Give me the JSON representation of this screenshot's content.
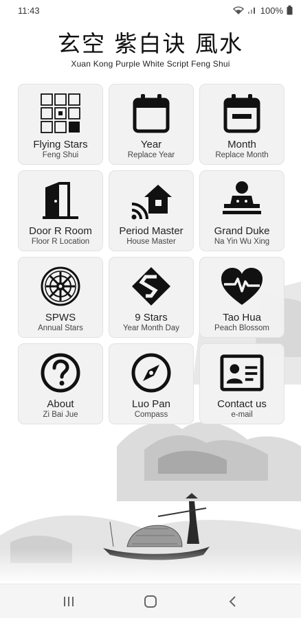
{
  "status_bar": {
    "time": "11:43",
    "battery": "100%",
    "icons": [
      "wifi-icon",
      "signal-icon",
      "battery-icon"
    ]
  },
  "header": {
    "title": "玄空 紫白诀 風水",
    "subtitle": "Xuan Kong Purple White Script Feng Shui"
  },
  "tiles": [
    {
      "icon": "flying-stars-grid-icon",
      "label": "Flying Stars",
      "sub": "Feng Shui"
    },
    {
      "icon": "calendar-icon",
      "label": "Year",
      "sub": "Replace Year"
    },
    {
      "icon": "calendar-month-icon",
      "label": "Month",
      "sub": "Replace Month"
    },
    {
      "icon": "door-icon",
      "label": "Door R Room",
      "sub": "Floor R Location"
    },
    {
      "icon": "house-signal-icon",
      "label": "Period Master",
      "sub": "House Master"
    },
    {
      "icon": "duke-icon",
      "label": "Grand Duke",
      "sub": "Na Yin Wu Xing"
    },
    {
      "icon": "wheel-icon",
      "label": "SPWS",
      "sub": "Annual Stars"
    },
    {
      "icon": "s-diamond-icon",
      "label": "9 Stars",
      "sub": "Year Month Day"
    },
    {
      "icon": "heart-pulse-icon",
      "label": "Tao Hua",
      "sub": "Peach Blossom"
    },
    {
      "icon": "help-circle-icon",
      "label": "About",
      "sub": "Zi Bai Jue"
    },
    {
      "icon": "compass-icon",
      "label": "Luo Pan",
      "sub": "Compass"
    },
    {
      "icon": "contact-card-icon",
      "label": "Contact us",
      "sub": "e-mail"
    }
  ],
  "nav_bar": {
    "buttons": [
      "recents-icon",
      "home-icon",
      "back-icon"
    ]
  },
  "colors": {
    "icon": "#111111",
    "tile_bg": "#f2f2f2",
    "background": "#ffffff"
  }
}
